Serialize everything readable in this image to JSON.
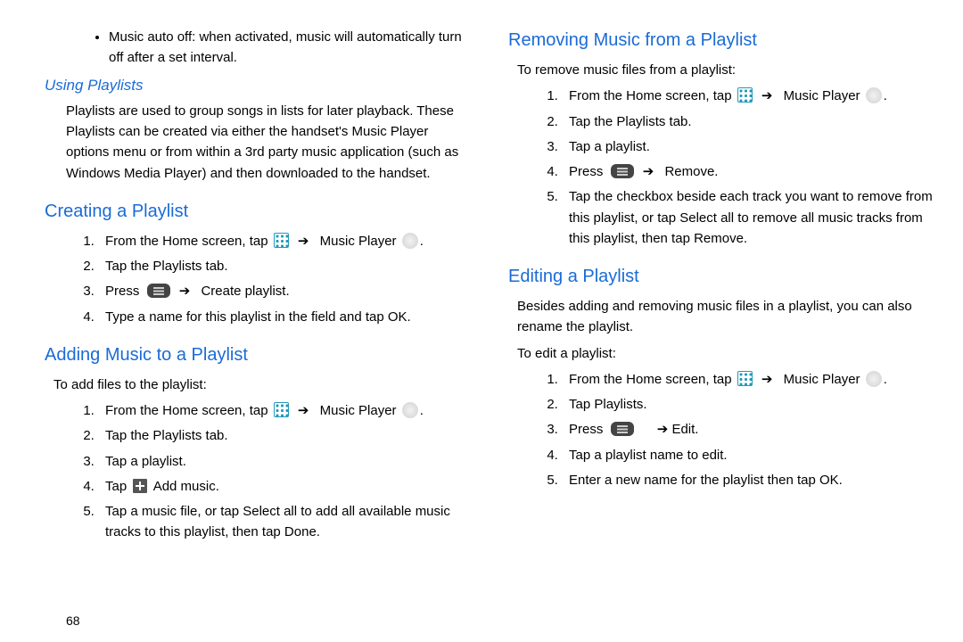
{
  "left": {
    "bullet_autooff": "Music auto off: when activated, music will automatically turn off after a set interval.",
    "using_h": "Using Playlists",
    "using_p": "Playlists are used to group songs in lists for later playback. These Playlists can be created via either the handset's Music Player options menu or from within a 3rd party music application (such as Windows Media Player) and then downloaded to the handset.",
    "creating_h": "Creating a Playlist",
    "creating_1a": "From the Home screen, tap",
    "creating_1b": "Music Player",
    "creating_2": "Tap the Playlists tab.",
    "creating_3a": "Press",
    "creating_3b": "Create playlist.",
    "creating_4": "Type a name for this playlist in the field and tap OK.",
    "adding_h": "Adding Music to a Playlist",
    "adding_intro": "To add files to the playlist:",
    "adding_1a": "From the Home screen, tap",
    "adding_1b": "Music Player",
    "adding_2": "Tap the Playlists tab.",
    "adding_3": "Tap a playlist.",
    "adding_4a": "Tap",
    "adding_4b": "Add music.",
    "adding_5": "Tap a music file, or tap Select all to add all available music tracks to this playlist, then tap Done.",
    "page_num": "68"
  },
  "right": {
    "removing_h": "Removing Music from a Playlist",
    "removing_intro": "To remove music files from a playlist:",
    "removing_1a": "From the Home screen, tap",
    "removing_1b": "Music Player",
    "removing_2": "Tap the Playlists tab.",
    "removing_3": "Tap a playlist.",
    "removing_4a": "Press",
    "removing_4b": "Remove.",
    "removing_5": "Tap the checkbox beside each track you want to remove from this playlist, or tap Select all to remove all music tracks from this playlist, then tap Remove.",
    "editing_h": "Editing a Playlist",
    "editing_p": "Besides adding and removing music files in a playlist, you can also rename the playlist.",
    "editing_intro": "To edit a playlist:",
    "editing_1a": "From the Home screen, tap",
    "editing_1b": "Music Player",
    "editing_2": "Tap Playlists.",
    "editing_3a": "Press",
    "editing_3b": "Edit.",
    "editing_4": "Tap a playlist name to edit.",
    "editing_5": "Enter a new name for the playlist then tap OK."
  }
}
